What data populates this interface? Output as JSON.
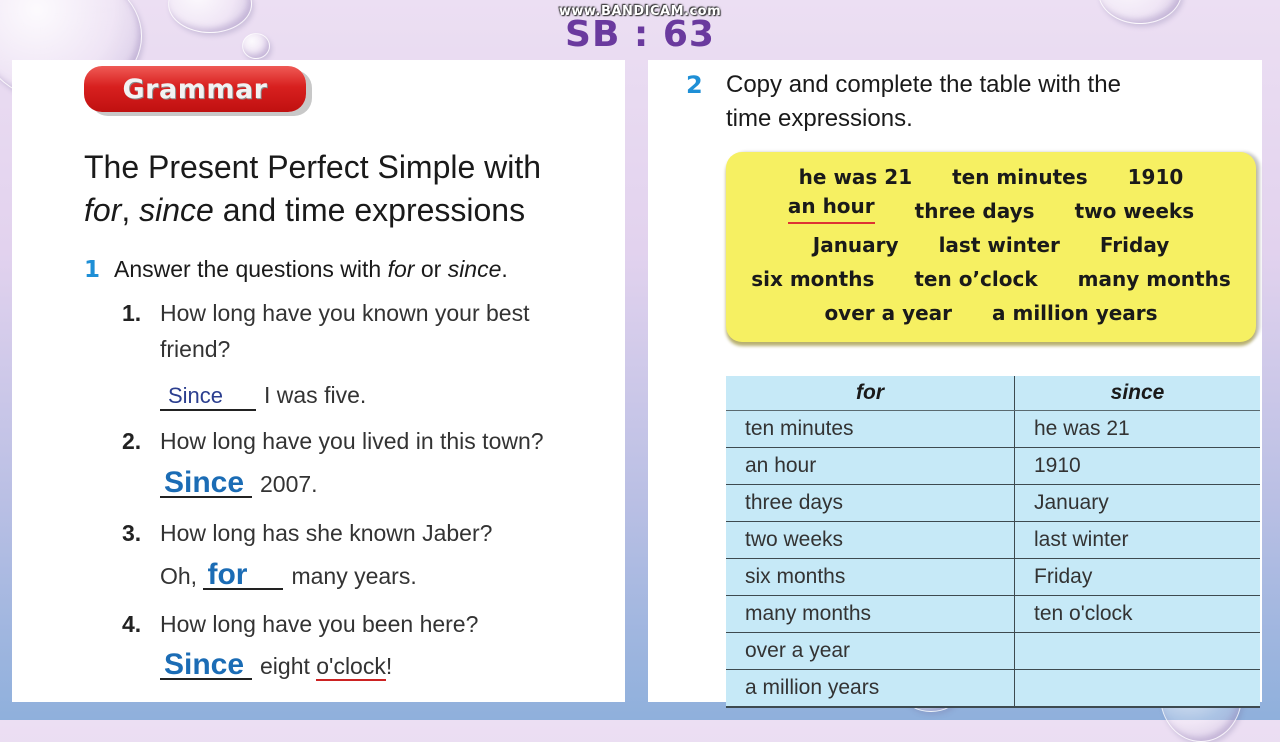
{
  "watermark": "www.BANDICAM.com",
  "slide_title": "SB : 63",
  "left_panel": {
    "badge": "Grammar",
    "heading": {
      "line1": "The Present Perfect Simple with",
      "word_for": "for",
      "comma": ", ",
      "word_since": "since",
      "line2_rest": " and time expressions"
    },
    "exercise1": {
      "number": "1",
      "instruction_pre": "Answer the questions with ",
      "instruction_for": "for",
      "instruction_or": " or ",
      "instruction_since": "since",
      "instruction_end": ".",
      "questions": [
        {
          "num": "1.",
          "line1": "How long have you known your best",
          "line2": "friend?",
          "answer_pre": "",
          "answer": "Since",
          "answer_post": "I was five.",
          "answer_style": "small"
        },
        {
          "num": "2.",
          "question": "How long have you lived in this town?",
          "answer_pre": "",
          "answer": "Since",
          "answer_post": "2007.",
          "answer_style": "big"
        },
        {
          "num": "3.",
          "question": "How long has she known Jaber?",
          "answer_pre": "Oh,",
          "answer": "for",
          "answer_post": "many years.",
          "answer_style": "big"
        },
        {
          "num": "4.",
          "question": "How long have you been here?",
          "answer_pre": "",
          "answer": "Since",
          "answer_post_a": "eight ",
          "answer_post_b": "o'clock",
          "answer_post_c": "!",
          "answer_style": "big"
        }
      ]
    }
  },
  "right_panel": {
    "exercise2": {
      "number": "2",
      "instruction_line1": "Copy and complete the table with the",
      "instruction_line2": "time expressions."
    },
    "word_box": {
      "rows": [
        [
          "he was 21",
          "ten minutes",
          "1910"
        ],
        [
          "an hour",
          "three days",
          "two weeks"
        ],
        [
          "January",
          "last winter",
          "Friday"
        ],
        [
          "six months",
          "ten o’clock",
          "many months"
        ],
        [
          "over a year",
          "a million years"
        ]
      ]
    },
    "table": {
      "headers": [
        "for",
        "since"
      ],
      "rows": [
        [
          "ten minutes",
          "he was 21"
        ],
        [
          "an hour",
          "1910"
        ],
        [
          "three days",
          "January"
        ],
        [
          "two weeks",
          "last winter"
        ],
        [
          "six months",
          "Friday"
        ],
        [
          "many months",
          "ten o'clock"
        ],
        [
          "over a year",
          ""
        ],
        [
          "a million years",
          ""
        ]
      ]
    }
  },
  "colors": {
    "title_purple": "#6a3a9e",
    "exercise_number_blue": "#1e8fd6",
    "answer_blue": "#1b6cb5",
    "badge_red": "#d8201f",
    "word_box_yellow": "#f6f062",
    "table_blue": "#c6e9f7"
  }
}
